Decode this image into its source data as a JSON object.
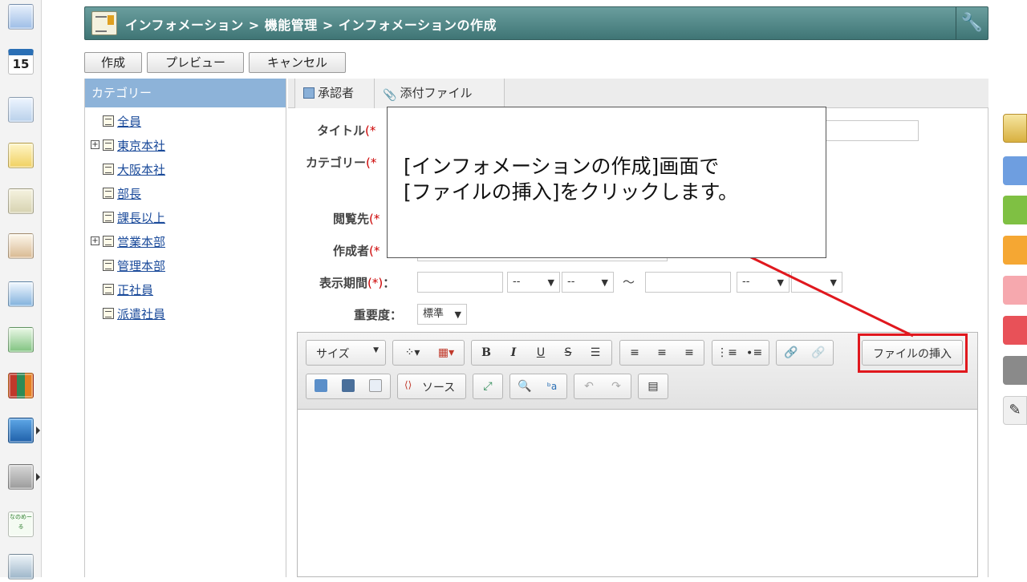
{
  "left_rail": {
    "items": [
      {
        "name": "portal-icon"
      },
      {
        "name": "calendar-icon",
        "text": "15"
      },
      {
        "name": "org-chart-icon"
      },
      {
        "name": "memo-icon"
      },
      {
        "name": "information-icon"
      },
      {
        "name": "clipboard-icon"
      },
      {
        "name": "question-icon"
      },
      {
        "name": "workflow-icon"
      },
      {
        "name": "binder-icon"
      },
      {
        "name": "neo-icon"
      },
      {
        "name": "folder-icon"
      },
      {
        "name": "app-banner-icon",
        "text": "なのめーる"
      },
      {
        "name": "app-banner-icon-2"
      }
    ]
  },
  "header": {
    "title": "インフォメーション > 機能管理 > インフォメーションの作成",
    "tool_icon": "wrench-icon"
  },
  "actions": {
    "create": "作成",
    "preview": "プレビュー",
    "cancel": "キャンセル"
  },
  "category_panel": {
    "title": "カテゴリー",
    "items": [
      {
        "label": "全員",
        "expandable": false
      },
      {
        "label": "東京本社",
        "expandable": true
      },
      {
        "label": "大阪本社",
        "expandable": false
      },
      {
        "label": "部長",
        "expandable": false
      },
      {
        "label": "課長以上",
        "expandable": false
      },
      {
        "label": "営業本部",
        "expandable": true
      },
      {
        "label": "管理本部",
        "expandable": false
      },
      {
        "label": "正社員",
        "expandable": false
      },
      {
        "label": "派遣社員",
        "expandable": false
      }
    ]
  },
  "tabs": {
    "approver": "承認者",
    "attachment": "添付ファイル"
  },
  "form": {
    "title_label": "タイトル",
    "category_label": "カテゴリー",
    "viewers_label": "閲覧先",
    "author_label": "作成者",
    "period_label": "表示期間",
    "importance_label": "重要度",
    "required_mark": "(*)",
    "colon": "：",
    "time_placeholder": "--",
    "tilde": "～",
    "importance_value": "標準"
  },
  "editor": {
    "size_label": "サイズ",
    "source_label": "ソース",
    "insert_file_label": "ファイルの挿入"
  },
  "callout": {
    "text": "[インフォメーションの作成]画面で\n[ファイルの挿入]をクリックします。"
  },
  "colors": {
    "header": "#4f8585",
    "category_header": "#8db3d9",
    "highlight": "#e0181e"
  }
}
